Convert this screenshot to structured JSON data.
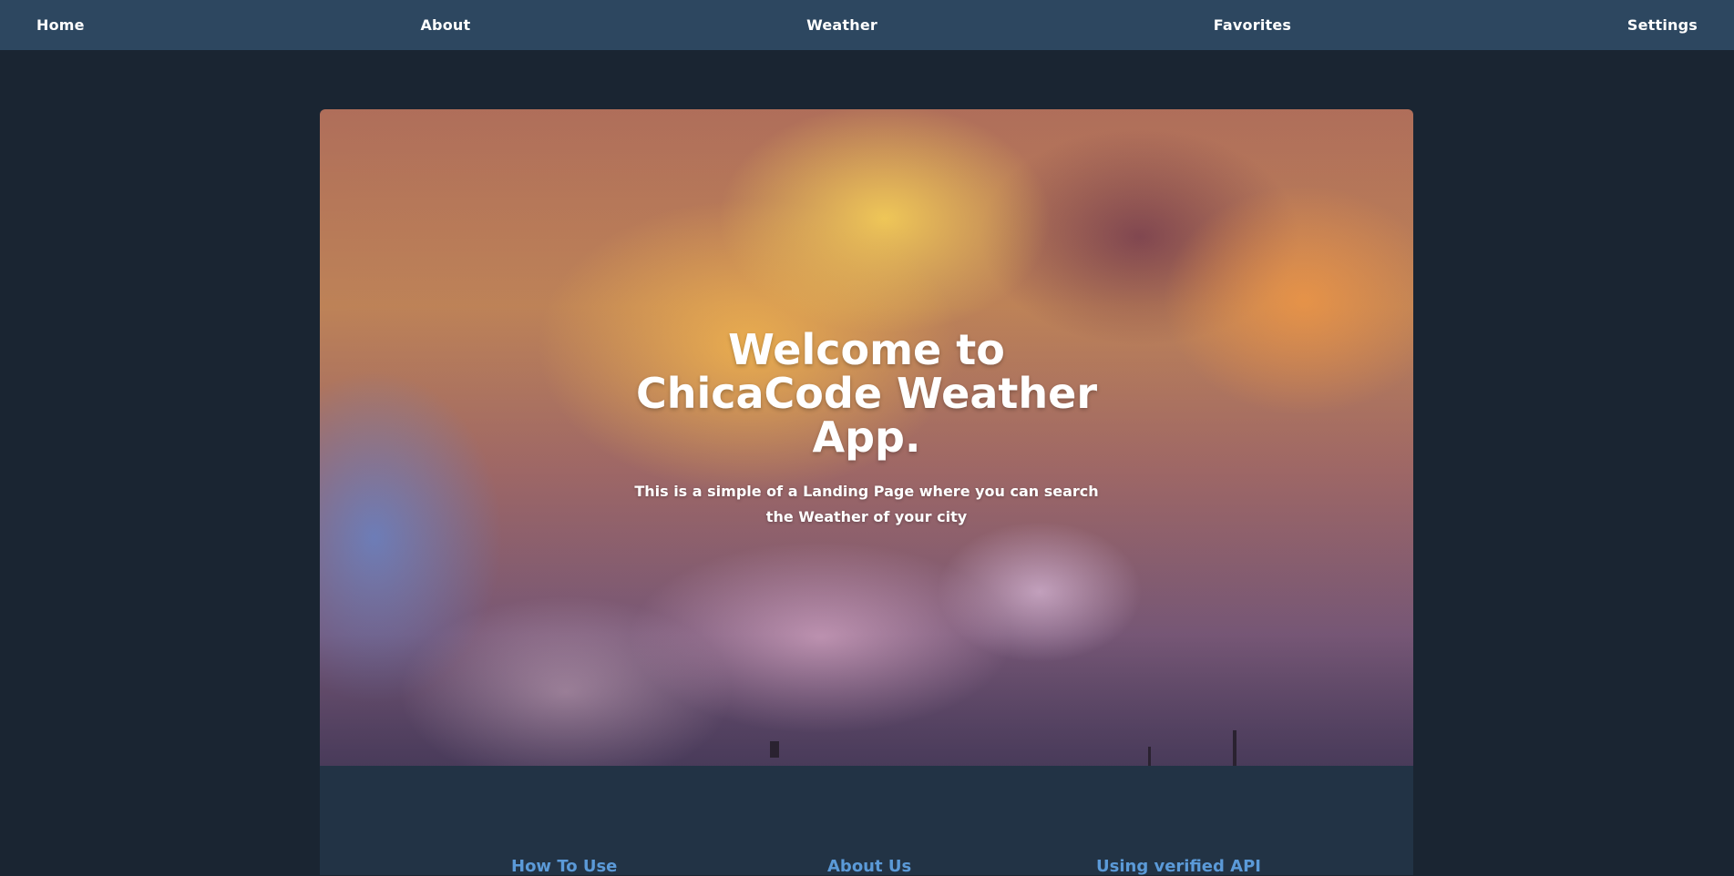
{
  "navbar": {
    "items": [
      {
        "label": "Home"
      },
      {
        "label": "About"
      },
      {
        "label": "Weather"
      },
      {
        "label": "Favorites"
      },
      {
        "label": "Settings"
      }
    ]
  },
  "hero": {
    "title": "Welcome to ChicaCode Weather App.",
    "subtitle": "This is a simple of a Landing Page where you can search the Weather of your city"
  },
  "info": {
    "links": [
      {
        "label": "How To Use"
      },
      {
        "label": "About Us"
      },
      {
        "label": "Using verified API"
      }
    ]
  },
  "colors": {
    "nav_bg": "#2d4760",
    "page_bg": "#1a2532",
    "info_bg": "#223345",
    "link_accent": "#5b9ad8"
  }
}
